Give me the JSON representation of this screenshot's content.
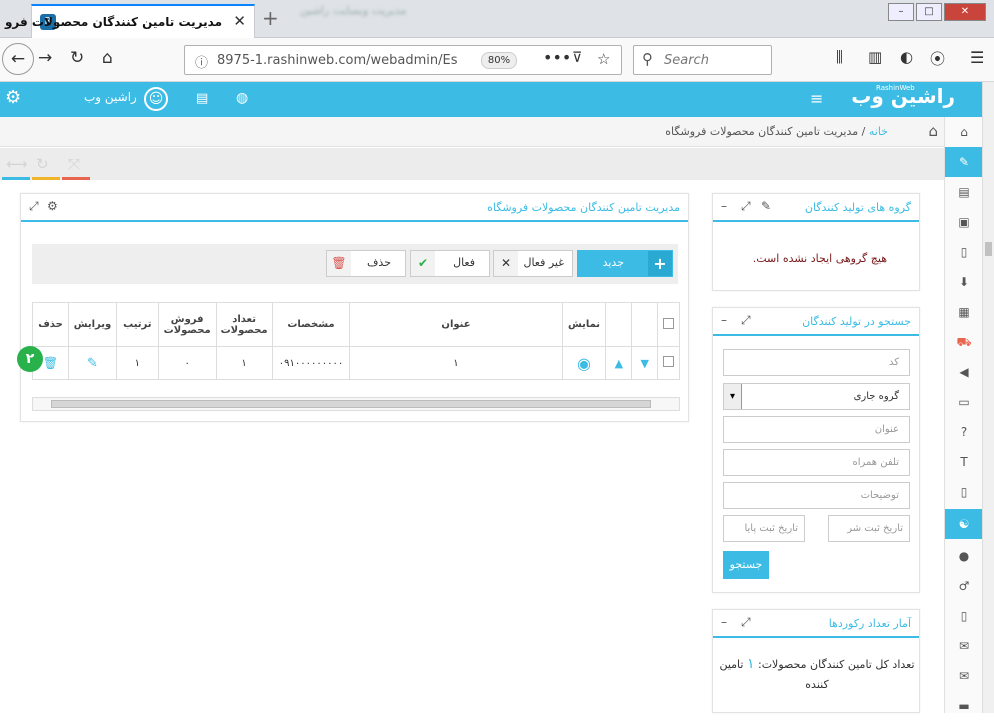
{
  "browser": {
    "tab_title": "مدیریت تامین کنندگان محصولات فرو",
    "tab_blur": "مدیریت وبسایت راشین",
    "url": "8975-1.rashinweb.com/webadmin/Es",
    "zoom": "80%",
    "search_placeholder": "Search"
  },
  "header": {
    "logo": "راشین وب",
    "logo_sub": "RashinWeb",
    "user": "راشین وب"
  },
  "breadcrumb": {
    "home": "خانه",
    "sep": "/",
    "current": "مدیریت تامین کنندگان محصولات فروشگاه"
  },
  "main": {
    "title": "مدیریت تامین کنندگان محصولات فروشگاه",
    "buttons": {
      "new": "جدید",
      "inactive": "غیر فعال",
      "active": "فعال",
      "delete": "حذف"
    },
    "columns": [
      "نمایش",
      "عنوان",
      "مشخصات",
      "تعداد محصولات",
      "فروش محصولات",
      "ترتیب",
      "ویرایش",
      "حذف"
    ],
    "row": {
      "title": "۱",
      "spec": "۰۹۱۰۰۰۰۰۰۰۰۰",
      "count": "۱",
      "sales": "۰",
      "order": "۱"
    },
    "badge": "۲"
  },
  "groups_panel": {
    "title": "گروه های تولید کنندگان",
    "empty": "هیچ گروهی ایجاد نشده است."
  },
  "search_panel": {
    "title": "جستجو در تولید کنندگان",
    "code": "کد",
    "group": "گروه جاری",
    "name": "عنوان",
    "phone": "تلفن همراه",
    "desc": "توضیحات",
    "date_start": "تاریخ ثبت شر",
    "date_end": "تاریخ ثبت پایا",
    "button": "جستجو"
  },
  "stats_panel": {
    "title": "آمار تعداد رکوردها",
    "label": "تعداد کل تامین کنندگان محصولات:",
    "value": "۱",
    "unit": "تامین کننده"
  },
  "colors": {
    "accent": "#3cbce4",
    "badge": "#29b14c",
    "delete": "#d9534f"
  }
}
